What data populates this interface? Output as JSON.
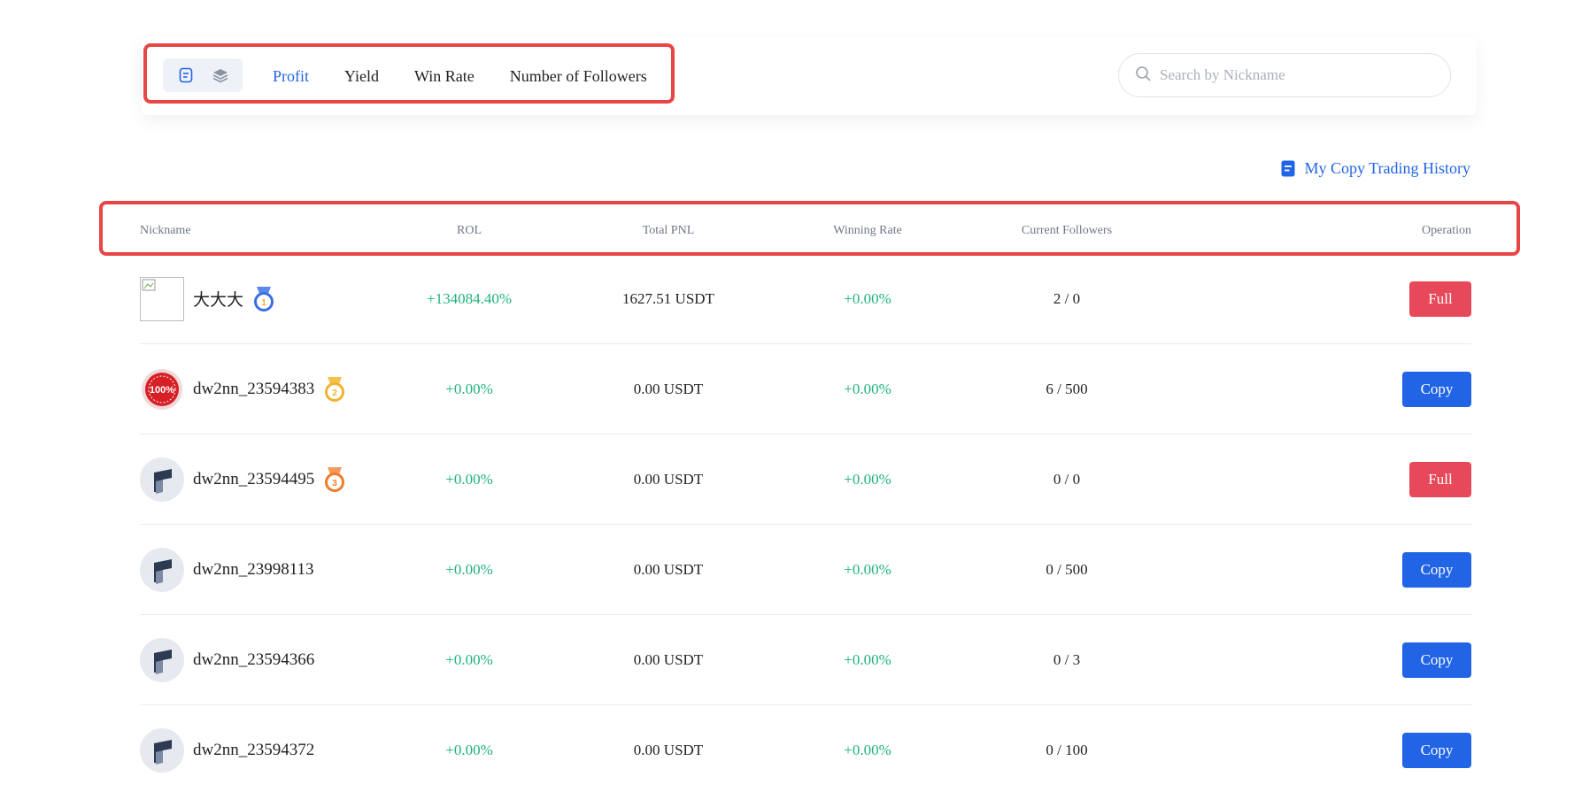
{
  "view_toggle": {
    "list_icon": "list-view-icon",
    "card_icon": "layers-view-icon"
  },
  "sort_tabs": [
    {
      "label": "Profit",
      "active": true
    },
    {
      "label": "Yield",
      "active": false
    },
    {
      "label": "Win Rate",
      "active": false
    },
    {
      "label": "Number of Followers",
      "active": false
    }
  ],
  "search": {
    "placeholder": "Search by Nickname",
    "value": ""
  },
  "history_link": {
    "label": "My Copy Trading History",
    "icon": "document-icon"
  },
  "table": {
    "headers": {
      "nickname": "Nickname",
      "rol": "ROL",
      "pnl": "Total PNL",
      "win": "Winning Rate",
      "followers": "Current Followers",
      "operation": "Operation"
    },
    "rows": [
      {
        "nickname": "大大大",
        "avatar": "broken-image",
        "medal": "1",
        "rol": "+134084.40%",
        "pnl": "1627.51 USDT",
        "win": "+0.00%",
        "followers": "2 / 0",
        "action": "Full"
      },
      {
        "nickname": "dw2nn_23594383",
        "avatar": "100-badge",
        "medal": "2",
        "rol": "+0.00%",
        "pnl": "0.00 USDT",
        "win": "+0.00%",
        "followers": "6 / 500",
        "action": "Copy"
      },
      {
        "nickname": "dw2nn_23594495",
        "avatar": "default",
        "medal": "3",
        "rol": "+0.00%",
        "pnl": "0.00 USDT",
        "win": "+0.00%",
        "followers": "0 / 0",
        "action": "Full"
      },
      {
        "nickname": "dw2nn_23998113",
        "avatar": "default",
        "medal": "",
        "rol": "+0.00%",
        "pnl": "0.00 USDT",
        "win": "+0.00%",
        "followers": "0 / 500",
        "action": "Copy"
      },
      {
        "nickname": "dw2nn_23594366",
        "avatar": "default",
        "medal": "",
        "rol": "+0.00%",
        "pnl": "0.00 USDT",
        "win": "+0.00%",
        "followers": "0 / 3",
        "action": "Copy"
      },
      {
        "nickname": "dw2nn_23594372",
        "avatar": "default",
        "medal": "",
        "rol": "+0.00%",
        "pnl": "0.00 USDT",
        "win": "+0.00%",
        "followers": "0 / 100",
        "action": "Copy"
      }
    ]
  },
  "colors": {
    "accent": "#2264e6",
    "positive": "#1fb37a",
    "full_button": "#e8495a",
    "highlight_box": "#e84545",
    "medal_gold_blue": "#3b6fe0",
    "medal_silver": "#f2b230",
    "medal_bronze": "#ef7a2d"
  }
}
